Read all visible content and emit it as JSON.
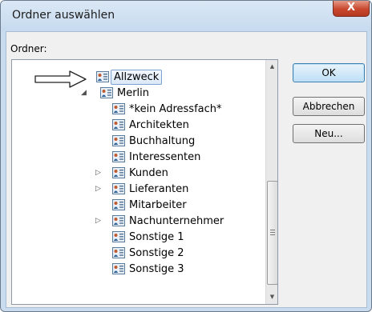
{
  "window": {
    "title": "Ordner auswählen",
    "close_label": "X"
  },
  "dialog": {
    "folder_label": "Ordner:"
  },
  "tree": {
    "items": [
      {
        "label": "Allzweck",
        "selected": true,
        "expander": "",
        "indent": 0
      },
      {
        "label": "Merlin",
        "selected": false,
        "expander": "◢",
        "indent": 1
      },
      {
        "label": "*kein Adressfach*",
        "selected": false,
        "expander": "",
        "indent": 2
      },
      {
        "label": "Architekten",
        "selected": false,
        "expander": "",
        "indent": 2
      },
      {
        "label": "Buchhaltung",
        "selected": false,
        "expander": "",
        "indent": 2
      },
      {
        "label": "Interessenten",
        "selected": false,
        "expander": "",
        "indent": 2
      },
      {
        "label": "Kunden",
        "selected": false,
        "expander": "▷",
        "indent": 2
      },
      {
        "label": "Lieferanten",
        "selected": false,
        "expander": "▷",
        "indent": 2
      },
      {
        "label": "Mitarbeiter",
        "selected": false,
        "expander": "",
        "indent": 2
      },
      {
        "label": "Nachunternehmer",
        "selected": false,
        "expander": "▷",
        "indent": 2
      },
      {
        "label": "Sonstige 1",
        "selected": false,
        "expander": "",
        "indent": 2
      },
      {
        "label": "Sonstige 2",
        "selected": false,
        "expander": "",
        "indent": 2
      },
      {
        "label": "Sonstige 3",
        "selected": false,
        "expander": "",
        "indent": 2
      }
    ]
  },
  "buttons": {
    "ok": "OK",
    "cancel": "Abbrechen",
    "new": "Neu..."
  },
  "colors": {
    "selection_border": "#7da2ce",
    "titlebar": "#c9dcef",
    "close_button": "#c8472d",
    "ok_border": "#3c7fb1"
  }
}
